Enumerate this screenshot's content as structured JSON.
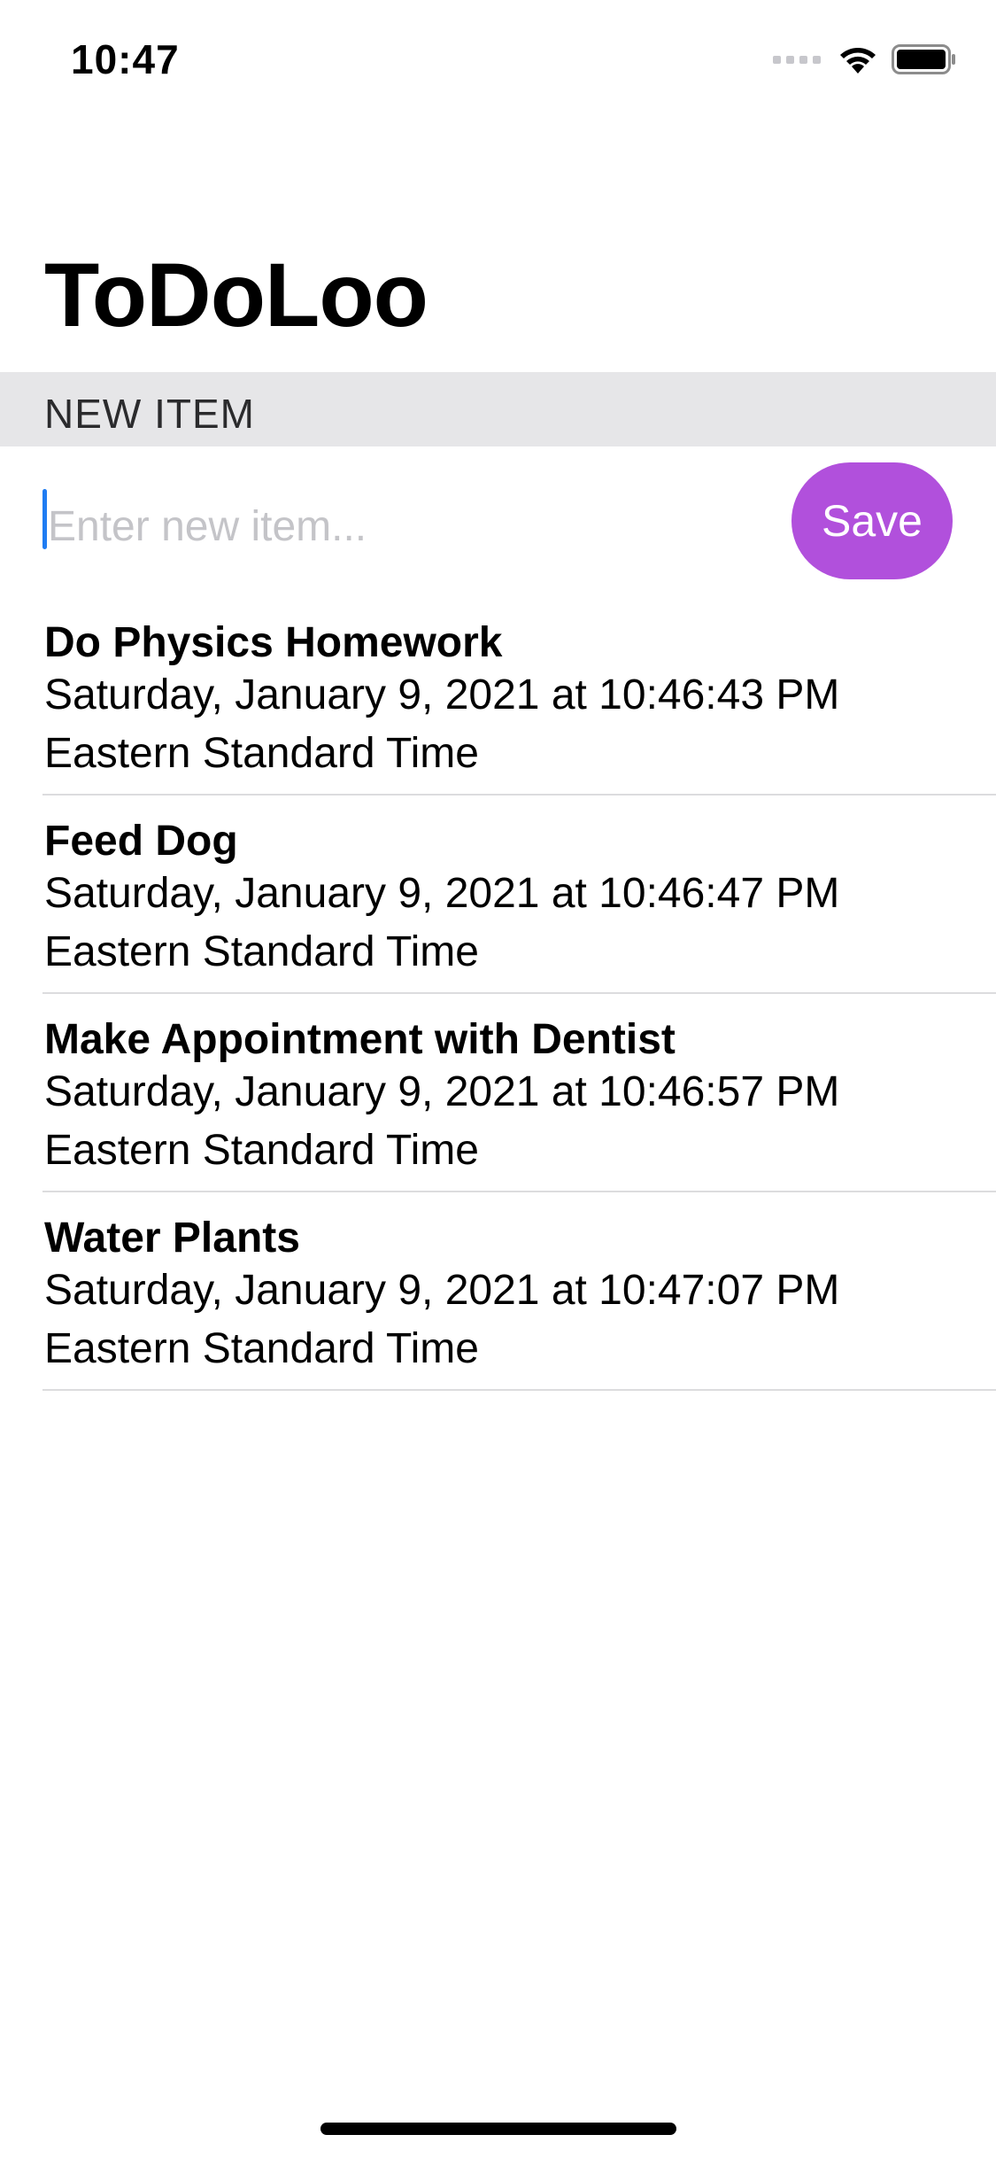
{
  "status_bar": {
    "time": "10:47"
  },
  "title": "ToDoLoo",
  "section": {
    "header": "NEW ITEM"
  },
  "input": {
    "placeholder": "Enter new item...",
    "value": ""
  },
  "save_button": {
    "label": "Save",
    "color": "#b150dc"
  },
  "items": [
    {
      "title": "Do Physics Homework",
      "date": "Saturday, January 9, 2021 at 10:46:43 PM Eastern Standard Time"
    },
    {
      "title": "Feed Dog",
      "date": "Saturday, January 9, 2021 at 10:46:47 PM Eastern Standard Time"
    },
    {
      "title": "Make Appointment with Dentist",
      "date": "Saturday, January 9, 2021 at 10:46:57 PM Eastern Standard Time"
    },
    {
      "title": "Water Plants",
      "date": "Saturday, January 9, 2021 at 10:47:07 PM Eastern Standard Time"
    }
  ],
  "icons": {
    "signal": "cellular-signal-icon",
    "wifi": "wifi-icon",
    "battery": "battery-icon"
  }
}
